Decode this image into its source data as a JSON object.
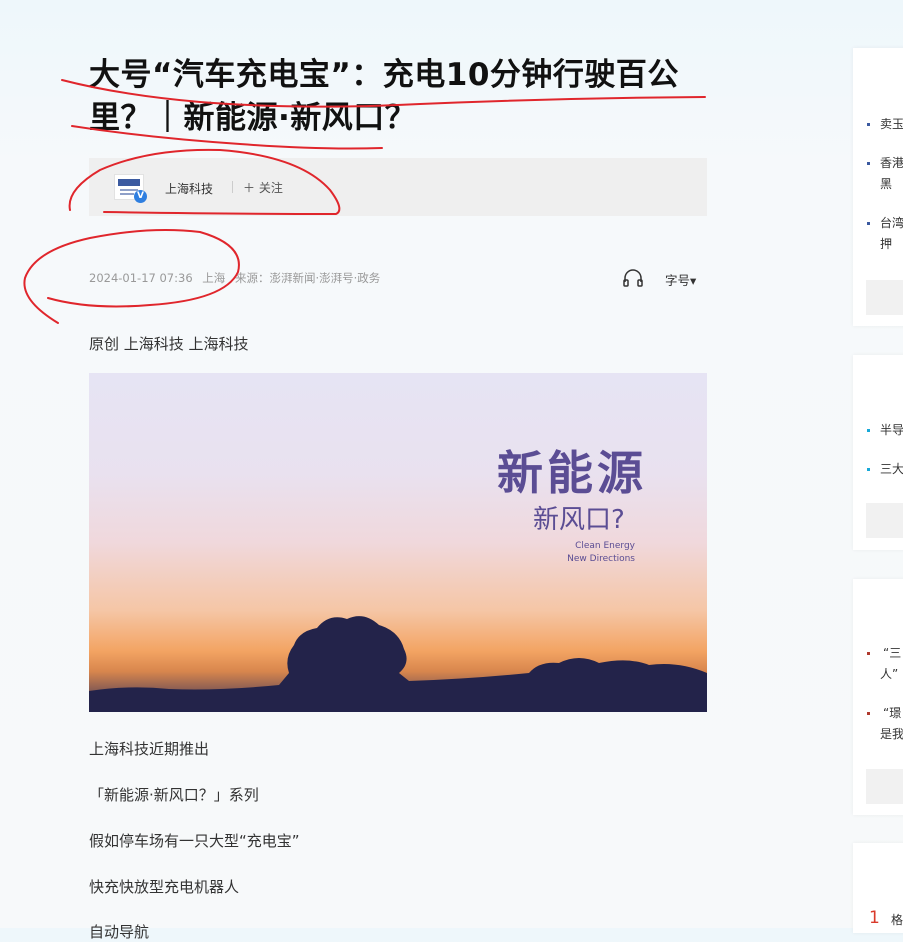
{
  "article": {
    "title": "大号“汽车充电宝”：充电10分钟行驶百公里？｜新能源·新风口？",
    "author": {
      "name": "上海科技",
      "follow_label": "＋ 关注",
      "verified_badge": "V"
    },
    "meta": {
      "datetime": "2024-01-17 07:36",
      "location": "上海",
      "source": "来源：澎湃新闻·澎湃号·政务"
    },
    "font_size_label": "字号▾",
    "original_line": "原创 上海科技 上海科技",
    "hero_image": {
      "line1": "新能源",
      "line2": "新风口?",
      "line3": "Clean Energy",
      "line4": "New Directions"
    },
    "paragraphs": [
      "上海科技近期推出",
      "「新能源·新风口？」系列",
      "假如停车场有一只大型“充电宝”",
      "快充快放型充电机器人",
      "自动导航"
    ]
  },
  "sidebar": {
    "block1": {
      "items": [
        "卖玉",
        "香港",
        "黑",
        "台湾",
        "押"
      ]
    },
    "block2": {
      "items": [
        "半导",
        "三大"
      ]
    },
    "block3": {
      "items": [
        "“三",
        "人”",
        "“璟",
        "是我"
      ]
    },
    "block4": {
      "rank_number": "1",
      "rank_text": "格"
    }
  },
  "colors": {
    "accent_blue": "#2f7fe0",
    "hero_text": "#5b4d94",
    "annotation_red": "#e0262c"
  }
}
